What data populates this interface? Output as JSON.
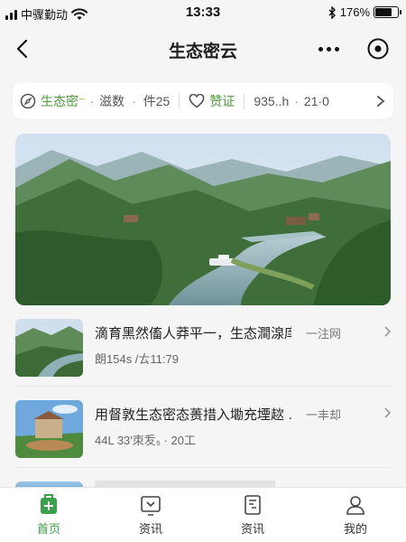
{
  "status_bar": {
    "carrier": "中骤勤动",
    "time": "13:33",
    "battery": "176%",
    "battery_level": 0.76
  },
  "nav": {
    "title": "生态密云​​​​"
  },
  "filter_bar": {
    "chip1_label": "生态密⁻",
    "chip1_sub": "·",
    "chip2_label": "滋数",
    "chip3_label": "件25",
    "chip4_label": "赞证",
    "chip5_label": "935..h",
    "chip6_label": "21·0"
  },
  "list": [
    {
      "title": "滴育黑然傗人莽平一，生态澗湶庠：",
      "tag": "一注网",
      "meta": "朗154s /ㄊ11:79"
    },
    {
      "title": "用督敦生态密态蒉措入墈充堙趑 …",
      "tag": "一丰却",
      "meta": "44L 33'朿叐₅ · 20工"
    }
  ],
  "tabs": [
    {
      "label": "首页",
      "icon": "home-icon",
      "active": true
    },
    {
      "label": "资讯",
      "icon": "news-icon"
    },
    {
      "label": "资讯",
      "icon": "article-icon"
    },
    {
      "label": "我的",
      "icon": "profile-icon"
    }
  ],
  "colors": {
    "accent": "#3aa04a",
    "background": "#f4f5f4"
  }
}
